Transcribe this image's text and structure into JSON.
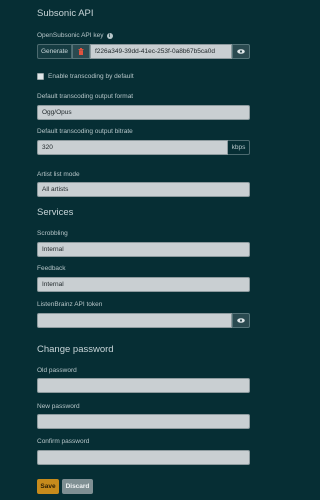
{
  "subsonic": {
    "title": "Subsonic API",
    "api_key_label": "OpenSubsonic API key",
    "generate_label": "Generate",
    "api_key_value": "f226a349-39dd-41ec-253f-0a8b67b5ca0d",
    "transcoding_label": "Enable transcoding by default",
    "format_label": "Default transcoding output format",
    "format_value": "Ogg/Opus",
    "bitrate_label": "Default transcoding output bitrate",
    "bitrate_value": "320",
    "bitrate_unit": "kbps",
    "artist_mode_label": "Artist list mode",
    "artist_mode_value": "All artists"
  },
  "services": {
    "title": "Services",
    "scrobbling_label": "Scrobbling",
    "scrobbling_value": "Internal",
    "feedback_label": "Feedback",
    "feedback_value": "Internal",
    "listenbrainz_label": "ListenBrainz API token",
    "listenbrainz_value": ""
  },
  "password": {
    "title": "Change password",
    "old_label": "Old password",
    "new_label": "New password",
    "confirm_label": "Confirm password"
  },
  "actions": {
    "save_label": "Save",
    "discard_label": "Discard"
  },
  "colors": {
    "background": "#062e34",
    "accent": "#c78b1c",
    "danger": "#c0392b"
  }
}
